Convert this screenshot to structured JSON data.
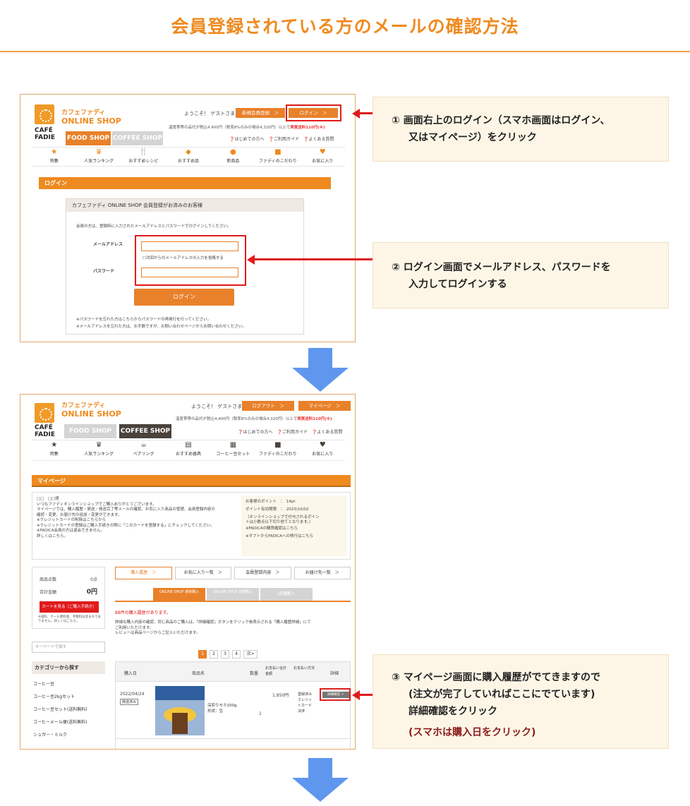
{
  "title": "会員登録されている方のメールの確認方法",
  "shot1": {
    "shop_l1": "カフェファディ",
    "shop_l2": "ONLINE SHOP",
    "brand1": "CAFÉ",
    "brand2": "FADIE",
    "welcome": "ようこそ！ ゲストさま",
    "btn_register": "新規会員登録　＞",
    "btn_login": "ログイン　＞",
    "notice": "温度帯等の品代が税込4,400円（税率8%のみの場合4,320円）以上で",
    "notice_red": "実質送料110円(※)",
    "tab_food": "FOOD SHOP",
    "tab_coffee": "COFFEE SHOP",
    "helps": "❓はじめての方へ　❓ご利用ガイド　❓よくある質問",
    "nav": [
      "特集",
      "人気ランキング",
      "おすすめレシピ",
      "おすすめ品",
      "新商品",
      "ファディのこだわり",
      "お気に入り"
    ],
    "bar": "ログイン",
    "box_title": "カフェファディ ONLINE SHOP 会員登録がお済みのお客様",
    "box_desc": "会員の方は、登録時に入力されたメールアドレスとパスワードでログインしてください。",
    "email_label": "メールアドレス",
    "remember": "☐次回からのメールアドレスの入力を省略する",
    "password_label": "パスワード",
    "login_btn": "ログイン",
    "note1": "※パスワードを忘れた方はこちらからパスワードの再発行を行ってください。",
    "note2": "※メールアドレスを忘れた方は、お手数ですが、お問い合わせページからお問い合わせください。"
  },
  "callout1": {
    "line1": "① 画面右上のログイン（スマホ画面はログイン、",
    "line2": "又はマイページ）をクリック"
  },
  "callout2": {
    "line1": "② ログイン画面でメールアドレス、パスワードを",
    "line2": "入力してログインする"
  },
  "shot2": {
    "welcome": "ようこそ！ ゲストさま",
    "btn_logout": "ログアウト　＞",
    "btn_mypage": "マイページ　＞",
    "nav": [
      "特集",
      "人気ランキング",
      "ペアリング",
      "おすすめ器具",
      "コーヒー豆セット",
      "ファディのこだわり",
      "お気に入り"
    ],
    "bar": "マイページ",
    "greet": [
      "□□　□□様",
      "いつもファディオンラインショップでご購入ありがとうございます。",
      "マイページでは、購入履歴・発送・発送完了等メールの確認、お気に入り商品の管理、会員登録内容の",
      "確認・変更、お届け先の追加・変更ができます。",
      "",
      "※クレジットカードの削除はこちらから",
      "※クレジットカードの登録はご購入手続きの際に「このカードを登録する」にチェックしてください。",
      "※FADICA会員の方は退会できません。",
      "詳しくはこちら。"
    ],
    "points": [
      "お客様のポイント　：　14pt",
      "ポイント有効期限　：　2023/10/02",
      "（オンラインショップで付与されるポイン",
      "トは小数点以下切り捨てとなります。）",
      "※FADICAの購買確認はこちら",
      "※ギフトからFADICAへの移行はこちら"
    ],
    "cart_count_label": "商品点数",
    "cart_count": "0点",
    "cart_total_label": "合計金額",
    "cart_total": "0円",
    "cart_btn": "カートを見る（ご購入手続き）",
    "cart_note": "※送料、クール便料金、手数料は含まれておりません。詳しくはこちら。",
    "search_placeholder": "キーワードで探す",
    "cat_title": "カテゴリーから探す",
    "cats": [
      "コーヒー豆",
      "コーヒー豆2kgセット",
      "コーヒー豆セット(送料無料)",
      "コーヒーメール便(送料無料)",
      "シュガー・ミルク"
    ],
    "tabs": [
      "購入履歴　＞",
      "お気に入り一覧　＞",
      "会員登録内容　＞",
      "お届け先一覧　＞"
    ],
    "sub_tabs": [
      "ONLINE SHOP 通常購入",
      "ONLINE SHOP 定期購入",
      "店舗購入"
    ],
    "count_text": "88件の購入履歴があります。",
    "explain": [
      "詳細な購入内容の確認、同じ商品のご購入は、「詳細確認」ボタンをクリック後表示される「購入履歴詳細」にて",
      "ご利用いただけます。",
      "レビューは商品ページからご記入いただけます。"
    ],
    "pages": [
      "1",
      "2",
      "3",
      "4",
      "次>"
    ],
    "headers": [
      "購入日",
      "商品名",
      "数量",
      "お支払い合計金額",
      "お支払い方法",
      "詳細"
    ],
    "row": {
      "date": "2022/04/24",
      "status": "発送済み",
      "product": "深煎りモカ100g",
      "product2": "形状：豆",
      "qty": "1",
      "total": "1,950円",
      "payment": "登録済みクレジットカード決済",
      "detail": "詳細確認 ＞"
    }
  },
  "callout3": {
    "line1": "③ マイページ画面に購入履歴がでてきますので",
    "line2": "(注文が完了していればここにでています)",
    "line3": "詳細確認をクリック",
    "line4": "(スマホは購入日をクリック)"
  }
}
